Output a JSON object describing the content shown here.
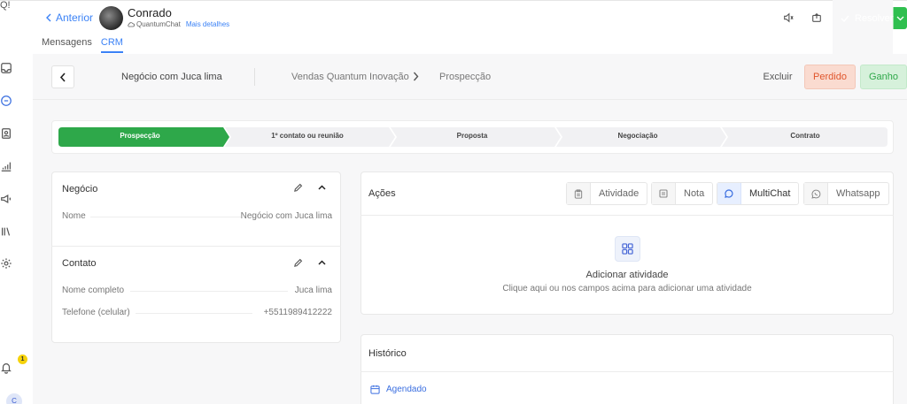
{
  "rail": {
    "logo_text": "Q!",
    "notification_count": "1",
    "user_initial": "C",
    "icons": [
      "inbox-icon",
      "chat-icon",
      "contacts-icon",
      "reports-icon",
      "campaigns-icon",
      "library-icon",
      "settings-icon",
      "bell-icon"
    ]
  },
  "header": {
    "back_label": "Anterior",
    "contact_name": "Conrado",
    "channel_name": "QuantumChat",
    "more_details": "Mais detalhes",
    "resolve_label": "Resolver"
  },
  "tabs": [
    {
      "label": "Mensagens",
      "active": false
    },
    {
      "label": "CRM",
      "active": true
    }
  ],
  "deal": {
    "title": "Negócio com Juca lima",
    "pipeline": "Vendas Quantum Inovação",
    "stage": "Prospecção",
    "delete_label": "Excluir",
    "lost_label": "Perdido",
    "won_label": "Ganho"
  },
  "stages": [
    {
      "label": "Prospecção",
      "active": true
    },
    {
      "label": "1º contato ou reunião",
      "active": false
    },
    {
      "label": "Proposta",
      "active": false
    },
    {
      "label": "Negociação",
      "active": false
    },
    {
      "label": "Contrato",
      "active": false
    }
  ],
  "business": {
    "title": "Negócio",
    "fields": [
      {
        "label": "Nome",
        "value": "Negócio com Juca lima"
      }
    ]
  },
  "contact": {
    "title": "Contato",
    "fields": [
      {
        "label": "Nome completo",
        "value": "Juca lima"
      },
      {
        "label": "Telefone (celular)",
        "value": "+5511989412222"
      }
    ]
  },
  "actions": {
    "title": "Ações",
    "buttons": [
      {
        "label": "Atividade",
        "icon": "clipboard-icon",
        "selected": false
      },
      {
        "label": "Nota",
        "icon": "note-icon",
        "selected": false
      },
      {
        "label": "MultiChat",
        "icon": "chat-bubble-icon",
        "selected": true
      },
      {
        "label": "Whatsapp",
        "icon": "whatsapp-icon",
        "selected": false
      }
    ],
    "empty_title": "Adicionar atividade",
    "empty_subtitle": "Clique aqui ou nos campos acima para adicionar uma atividade"
  },
  "history": {
    "title": "Histórico",
    "items": [
      {
        "label": "Agendado",
        "icon": "calendar-icon"
      }
    ]
  },
  "colors": {
    "accent": "#3b82f6",
    "success": "#2fbf4f",
    "stage_active": "#2ea84a",
    "lost": "#e0552b"
  }
}
